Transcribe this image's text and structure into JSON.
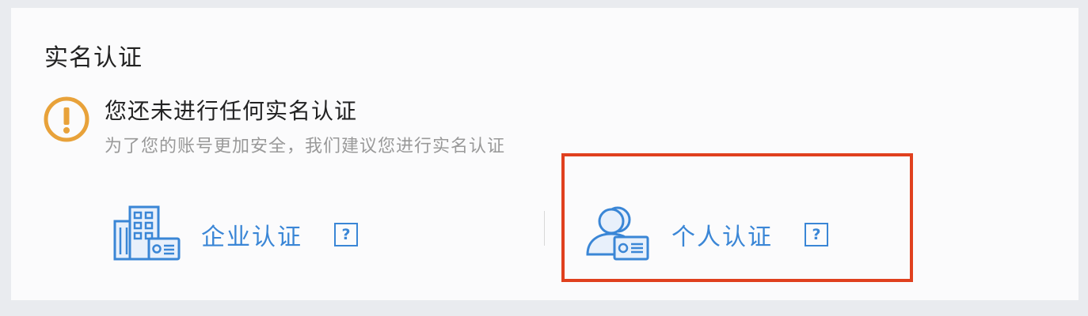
{
  "section": {
    "title": "实名认证"
  },
  "notice": {
    "icon": "warning-circle-icon",
    "title": "您还未进行任何实名认证",
    "subtitle": "为了您的账号更加安全，我们建议您进行实名认证"
  },
  "options": {
    "company": {
      "icon": "company-building-id-card-icon",
      "label": "企业认证",
      "help": "?"
    },
    "personal": {
      "icon": "person-id-card-icon",
      "label": "个人认证",
      "help": "?"
    }
  },
  "colors": {
    "accent": "#3a86d6",
    "warning": "#e8a23a",
    "highlight": "#e0401e"
  }
}
